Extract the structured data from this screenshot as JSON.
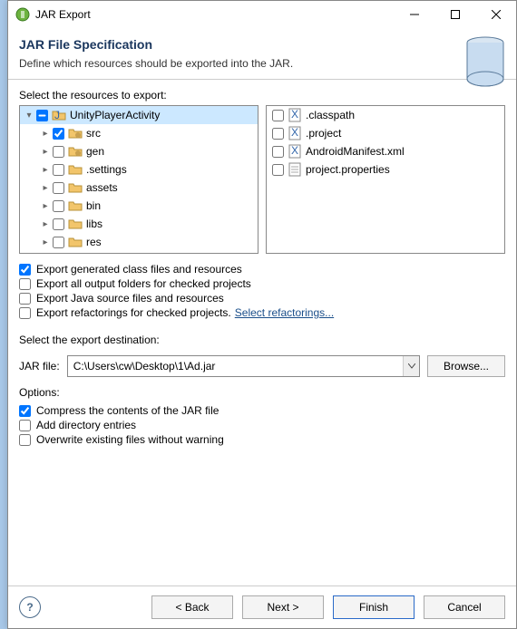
{
  "window": {
    "title": "JAR Export"
  },
  "header": {
    "title": "JAR File Specification",
    "description": "Define which resources should be exported into the JAR."
  },
  "resources": {
    "label": "Select the resources to export:",
    "left_tree": [
      {
        "label": "UnityPlayerActivity",
        "depth": 0,
        "checked": "mixed",
        "expanded": true,
        "selected": true,
        "icon": "project"
      },
      {
        "label": "src",
        "depth": 1,
        "checked": true,
        "expanded": false,
        "icon": "package"
      },
      {
        "label": "gen",
        "depth": 1,
        "checked": false,
        "expanded": false,
        "icon": "package"
      },
      {
        "label": ".settings",
        "depth": 1,
        "checked": false,
        "expanded": false,
        "icon": "folder"
      },
      {
        "label": "assets",
        "depth": 1,
        "checked": false,
        "expanded": false,
        "icon": "folder"
      },
      {
        "label": "bin",
        "depth": 1,
        "checked": false,
        "expanded": false,
        "icon": "folder"
      },
      {
        "label": "libs",
        "depth": 1,
        "checked": false,
        "expanded": false,
        "icon": "folder"
      },
      {
        "label": "res",
        "depth": 1,
        "checked": false,
        "expanded": false,
        "icon": "folder"
      }
    ],
    "right_list": [
      {
        "label": ".classpath",
        "checked": false,
        "icon": "xmlfile"
      },
      {
        "label": ".project",
        "checked": false,
        "icon": "xmlfile"
      },
      {
        "label": "AndroidManifest.xml",
        "checked": false,
        "icon": "xmlfile"
      },
      {
        "label": "project.properties",
        "checked": false,
        "icon": "file"
      }
    ]
  },
  "export_options": [
    {
      "label": "Export generated class files and resources",
      "checked": true
    },
    {
      "label": "Export all output folders for checked projects",
      "checked": false
    },
    {
      "label": "Export Java source files and resources",
      "checked": false
    },
    {
      "label": "Export refactorings for checked projects.",
      "checked": false,
      "link": "Select refactorings..."
    }
  ],
  "destination": {
    "label": "Select the export destination:",
    "field_label": "JAR file:",
    "path": "C:\\Users\\cw\\Desktop\\1\\Ad.jar",
    "browse": "Browse..."
  },
  "options": {
    "label": "Options:",
    "items": [
      {
        "label": "Compress the contents of the JAR file",
        "checked": true
      },
      {
        "label": "Add directory entries",
        "checked": false
      },
      {
        "label": "Overwrite existing files without warning",
        "checked": false
      }
    ]
  },
  "buttons": {
    "back": "< Back",
    "next": "Next >",
    "finish": "Finish",
    "cancel": "Cancel"
  }
}
